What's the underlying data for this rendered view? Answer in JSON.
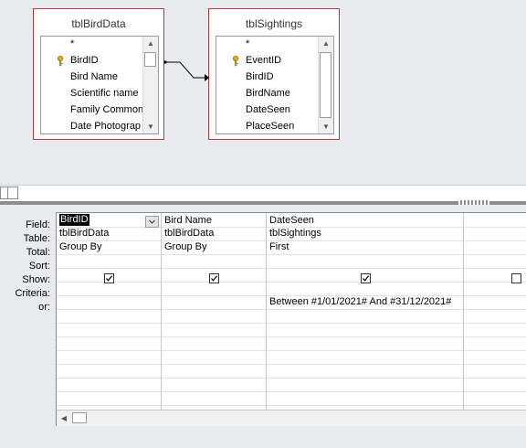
{
  "design_pane": {
    "tables": [
      {
        "title": "tblBirdData",
        "fields": [
          "*",
          "BirdID",
          "Bird Name",
          "Scientific name",
          "Family Common",
          "Date Photograp"
        ],
        "key_field": "BirdID",
        "key_icon": "key-icon"
      },
      {
        "title": "tblSightings",
        "fields": [
          "*",
          "EventID",
          "BirdID",
          "BirdName",
          "DateSeen",
          "PlaceSeen"
        ],
        "key_field": "EventID",
        "key_icon": "key-icon"
      }
    ],
    "relationship": "tblBirdData.BirdID - tblSightings.BirdID"
  },
  "grid": {
    "row_labels": {
      "field": "Field:",
      "table": "Table:",
      "total": "Total:",
      "sort": "Sort:",
      "show": "Show:",
      "criteria": "Criteria:",
      "or": "or:"
    },
    "columns": [
      {
        "field": "BirdID",
        "table": "tblBirdData",
        "total": "Group By",
        "sort": "",
        "show": true,
        "criteria": "",
        "or": ""
      },
      {
        "field": "Bird Name",
        "table": "tblBirdData",
        "total": "Group By",
        "sort": "",
        "show": true,
        "criteria": "",
        "or": ""
      },
      {
        "field": "DateSeen",
        "table": "tblSightings",
        "total": "First",
        "sort": "",
        "show": true,
        "criteria": "Between #1/01/2021# And #31/12/2021#",
        "or": ""
      },
      {
        "field": "",
        "table": "",
        "total": "",
        "sort": "",
        "show": false,
        "criteria": "",
        "or": ""
      }
    ]
  },
  "colors": {
    "table_border": "#b0413e",
    "pane_background": "#e9eaee",
    "field_selection": "#000000"
  }
}
